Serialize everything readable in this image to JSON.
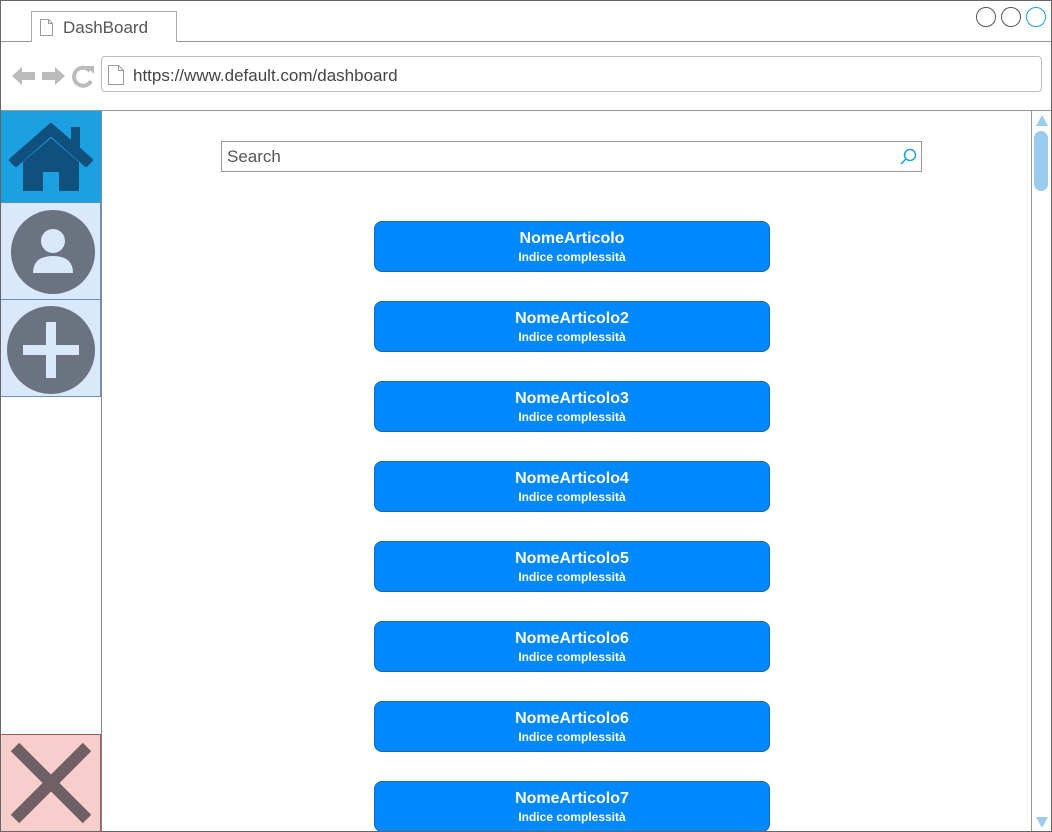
{
  "browser": {
    "tab_title": "DashBoard",
    "url": "https://www.default.com/dashboard"
  },
  "sidebar": {
    "items": [
      {
        "name": "home",
        "icon": "home-icon"
      },
      {
        "name": "profile",
        "icon": "user-icon"
      },
      {
        "name": "add",
        "icon": "plus-icon"
      },
      {
        "name": "close",
        "icon": "close-icon"
      }
    ]
  },
  "search": {
    "placeholder": "Search"
  },
  "articles": [
    {
      "name": "NomeArticolo",
      "subtitle": "Indice complessità"
    },
    {
      "name": "NomeArticolo2",
      "subtitle": "Indice complessità"
    },
    {
      "name": "NomeArticolo3",
      "subtitle": "Indice complessità"
    },
    {
      "name": "NomeArticolo4",
      "subtitle": "Indice complessità"
    },
    {
      "name": "NomeArticolo5",
      "subtitle": "Indice complessità"
    },
    {
      "name": "NomeArticolo6",
      "subtitle": "Indice complessità"
    },
    {
      "name": "NomeArticolo6",
      "subtitle": "Indice complessità"
    },
    {
      "name": "NomeArticolo7",
      "subtitle": "Indice complessità"
    }
  ],
  "colors": {
    "accent": "#0088ff",
    "home_bg": "#1ba1e2",
    "nav_bg": "#dae8fc",
    "close_bg": "#f8cecc",
    "scroll": "#99ccee"
  }
}
